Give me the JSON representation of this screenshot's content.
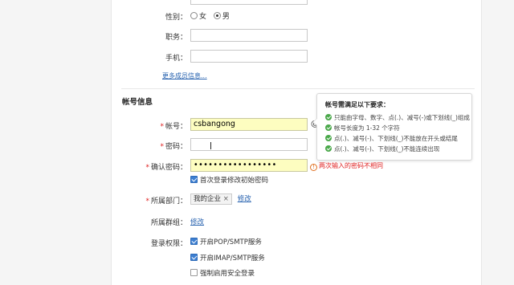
{
  "gender": {
    "label": "性别：",
    "options": [
      {
        "label": "女",
        "selected": false
      },
      {
        "label": "男",
        "selected": true
      }
    ]
  },
  "position": {
    "label": "职务：",
    "value": ""
  },
  "mobile": {
    "label": "手机：",
    "value": ""
  },
  "more_info_link": "更多成员信息...",
  "account_section": {
    "title": "帐号信息"
  },
  "account": {
    "label": "帐号：",
    "value": "csbangong",
    "suffix": "@"
  },
  "password": {
    "label": "密码：",
    "value": ""
  },
  "confirm_password": {
    "label": "确认密码：",
    "value": "•••••••••••••••••",
    "error_icon": "!",
    "error": "两次输入的密码不相同"
  },
  "first_login_change": {
    "label": "首次登录修改初始密码",
    "checked": true
  },
  "department": {
    "label": "所属部门：",
    "tag": "我的企业",
    "tag_remove": "×",
    "edit": "修改"
  },
  "group": {
    "label": "所属群组：",
    "edit": "修改"
  },
  "permissions": {
    "label": "登录权限：",
    "items": [
      {
        "label": "开启POP/SMTP服务",
        "checked": true
      },
      {
        "label": "开启IMAP/SMTP服务",
        "checked": true
      },
      {
        "label": "强制启用安全登录",
        "checked": false
      }
    ]
  },
  "tooltip": {
    "title": "帐号需满足以下要求：",
    "rules": [
      "只能由字母、数字、点(.)、减号(-)或下划线(_)组成",
      "帐号长度为 1-32 个字符",
      "点(.)、减号(-)、下划线(_)不能放在开头或结尾",
      "点(.)、减号(-)、下划线(_)不能连续出现"
    ]
  },
  "colors": {
    "accent": "#3d7fd1",
    "link": "#2a64b0",
    "error": "#e02020",
    "success": "#4aa84a",
    "highlight": "#fdfdc0"
  },
  "icons": {
    "rule_ok": "check-circle-icon",
    "field_error": "warning-circle-icon"
  }
}
